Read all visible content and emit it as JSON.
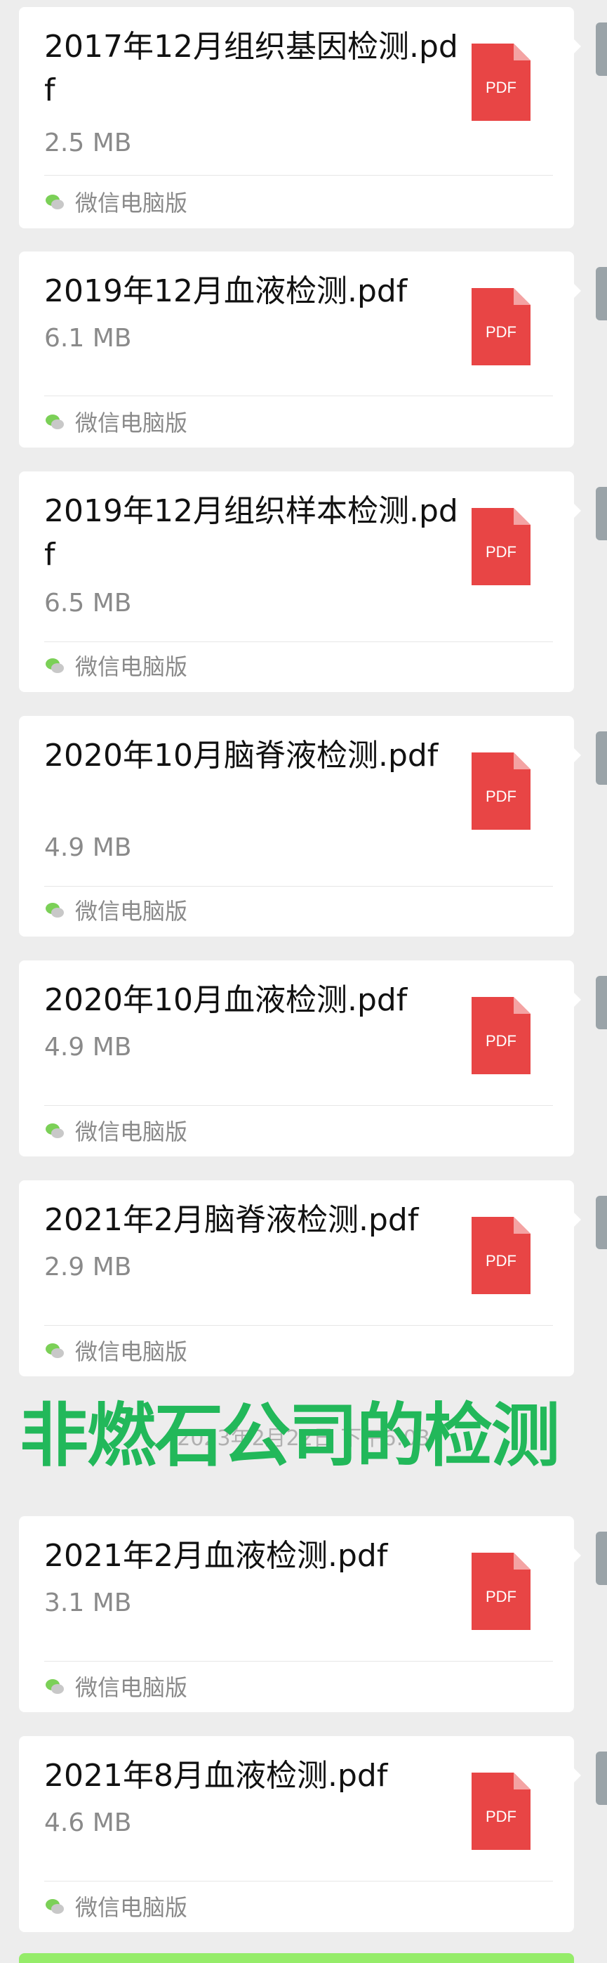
{
  "messages": [
    {
      "file_name": "2017年12月组织基因检测.pdf",
      "size": "2.5 MB",
      "source": "微信电脑版",
      "icon": "pdf-icon"
    },
    {
      "file_name": "2019年12月血液检测.pdf",
      "size": "6.1 MB",
      "source": "微信电脑版",
      "icon": "pdf-icon"
    },
    {
      "file_name": "2019年12月组织样本检测.pdf",
      "size": "6.5 MB",
      "source": "微信电脑版",
      "icon": "pdf-icon"
    },
    {
      "file_name": "2020年10月脑脊液检测.pdf",
      "size": "4.9 MB",
      "source": "微信电脑版",
      "icon": "pdf-icon"
    },
    {
      "file_name": "2020年10月血液检测.pdf",
      "size": "4.9 MB",
      "source": "微信电脑版",
      "icon": "pdf-icon"
    },
    {
      "file_name": "2021年2月脑脊液检测.pdf",
      "size": "2.9 MB",
      "source": "微信电脑版",
      "icon": "pdf-icon"
    },
    {
      "file_name": "2021年2月血液检测.pdf",
      "size": "3.1 MB",
      "source": "微信电脑版",
      "icon": "pdf-icon"
    },
    {
      "file_name": "2021年8月血液检测.pdf",
      "size": "4.6 MB",
      "source": "微信电脑版",
      "icon": "pdf-icon"
    }
  ],
  "separator": {
    "timestamp": "2023年2月22日 下午6:03",
    "overlay_text": "非燃石公司的检测"
  },
  "pdf_badge": "PDF",
  "colors": {
    "pdf_red": "#e84545",
    "overlay_green": "#22b85a",
    "wechat_green": "#95ec69",
    "background": "#ededed"
  }
}
